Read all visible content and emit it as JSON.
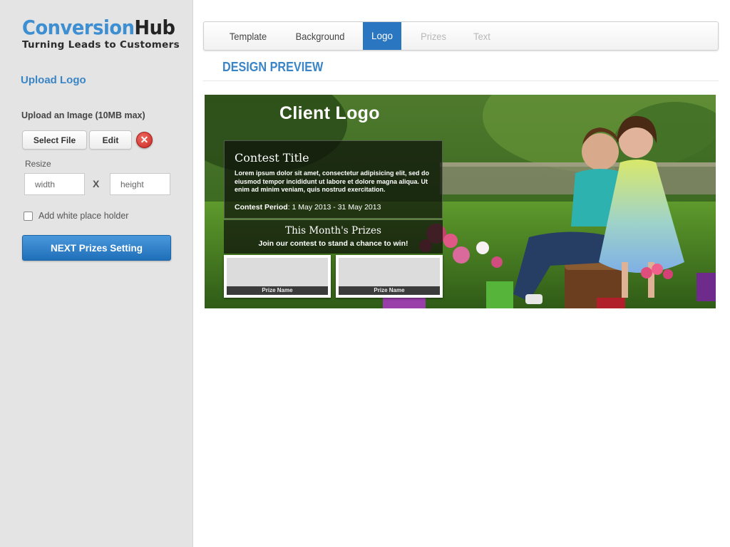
{
  "brand": {
    "name_part1": "Conversion",
    "name_part2": "Hub",
    "tagline": "Turning Leads to Customers"
  },
  "sidebar": {
    "section_title": "Upload Logo",
    "upload_label": "Upload an Image (10MB max)",
    "select_file_label": "Select File",
    "edit_label": "Edit",
    "remove_glyph": "✕",
    "resize_label": "Resize",
    "width_placeholder": "width",
    "height_placeholder": "height",
    "separator": "X",
    "checkbox_label": "Add white place holder",
    "checkbox_checked": false,
    "next_button_label": "NEXT Prizes Setting"
  },
  "tabs": [
    {
      "label": "Template",
      "state": "enabled"
    },
    {
      "label": "Background",
      "state": "enabled"
    },
    {
      "label": "Logo",
      "state": "active"
    },
    {
      "label": "Prizes",
      "state": "disabled"
    },
    {
      "label": "Text",
      "state": "disabled"
    }
  ],
  "main": {
    "design_title": "DESIGN PREVIEW"
  },
  "preview": {
    "client_logo": "Client Logo",
    "contest_title": "Contest Title",
    "contest_body": "Lorem ipsum dolor sit amet, consectetur adipisicing elit, sed do eiusmod tempor incididunt ut labore et dolore magna aliqua. Ut enim ad minim veniam, quis nostrud exercitation.",
    "period_label": "Contest Period",
    "period_value": ": 1 May 2013 - 31 May 2013",
    "prizes_title": "This Month's Prizes",
    "prizes_subtitle": "Join our contest to stand a chance to win!",
    "prize_cards": [
      {
        "caption": "Prize Name"
      },
      {
        "caption": "Prize Name"
      }
    ]
  },
  "colors": {
    "accent": "#3a85c6",
    "active_tab": "#2a76c0",
    "sidebar_bg": "#e4e4e4",
    "remove_red": "#d0342c"
  }
}
